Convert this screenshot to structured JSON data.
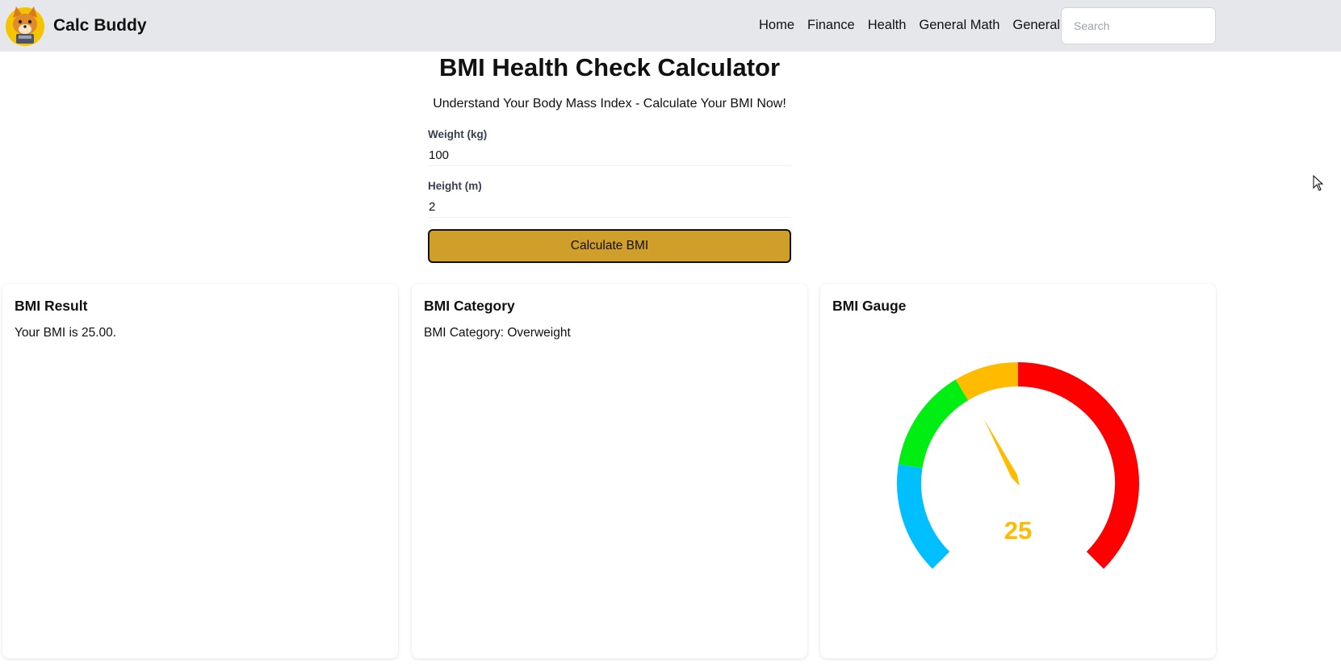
{
  "nav": {
    "brand": "Calc Buddy",
    "links": [
      "Home",
      "Finance",
      "Health",
      "General Math",
      "General"
    ],
    "search_placeholder": "Search"
  },
  "header": {
    "title": "BMI Health Check Calculator",
    "subtitle": "Understand Your Body Mass Index - Calculate Your BMI Now!"
  },
  "form": {
    "weight_label": "Weight (kg)",
    "weight_value": "100",
    "height_label": "Height (m)",
    "height_value": "2",
    "button_label": "Calculate BMI"
  },
  "cards": {
    "result": {
      "title": "BMI Result",
      "text": "Your BMI is 25.00."
    },
    "category": {
      "title": "BMI Category",
      "text": "BMI Category: Overweight"
    },
    "gauge": {
      "title": "BMI Gauge",
      "value_label": "25",
      "value": 25,
      "value_color": "#ffbb00",
      "segment_colors": [
        "#00bfff",
        "#00ee11",
        "#ffbb00",
        "#ff0000"
      ]
    }
  },
  "icons": {
    "logo": "fox-mascot-logo",
    "cursor": "mouse-pointer-icon"
  }
}
